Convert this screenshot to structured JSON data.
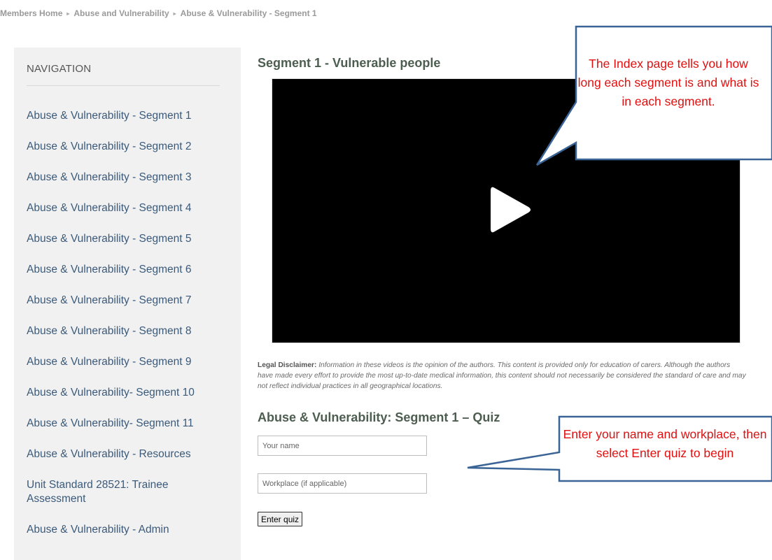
{
  "breadcrumb": {
    "items": [
      "Members Home",
      "Abuse and Vulnerability",
      "Abuse & Vulnerability - Segment 1"
    ],
    "separator": "▸"
  },
  "sidebar": {
    "title": "NAVIGATION",
    "items": [
      "Abuse & Vulnerability - Segment 1",
      "Abuse & Vulnerability - Segment 2",
      "Abuse & Vulnerability - Segment 3",
      "Abuse & Vulnerability - Segment 4",
      "Abuse & Vulnerability - Segment 5",
      "Abuse & Vulnerability - Segment 6",
      "Abuse & Vulnerability - Segment 7",
      "Abuse & Vulnerability - Segment 8",
      "Abuse & Vulnerability - Segment 9",
      "Abuse & Vulnerability- Segment 10",
      "Abuse & Vulnerability- Segment 11",
      "Abuse & Vulnerability - Resources",
      "Unit Standard 28521: Trainee Assessment",
      "Abuse & Vulnerability - Admin"
    ]
  },
  "main": {
    "segment_title": "Segment 1 - Vulnerable people",
    "video": {
      "icon": "play-icon"
    },
    "disclaimer": {
      "label": "Legal Disclaimer:",
      "text": "Information in these videos is the opinion of the authors. This content is provided only for education of carers. Although the authors have made every effort to provide the most up-to-date medical information, this content should not necessarily be considered the standard of care and may not reflect individual practices in all geographical locations."
    },
    "quiz": {
      "title": "Abuse & Vulnerability: Segment 1 – Quiz",
      "name_placeholder": "Your name",
      "workplace_placeholder": "Workplace (if applicable)",
      "enter_label": "Enter quiz"
    }
  },
  "callouts": {
    "index": "The Index page tells you how long each segment is and what is in each segment.",
    "quiz": "Enter your name and workplace, then select Enter quiz to begin"
  },
  "colors": {
    "callout_border": "#3b6496",
    "callout_text": "#e01010",
    "nav_link": "#3b5a7a",
    "heading": "#4d5e51",
    "sidebar_bg": "#f1f1f1"
  }
}
